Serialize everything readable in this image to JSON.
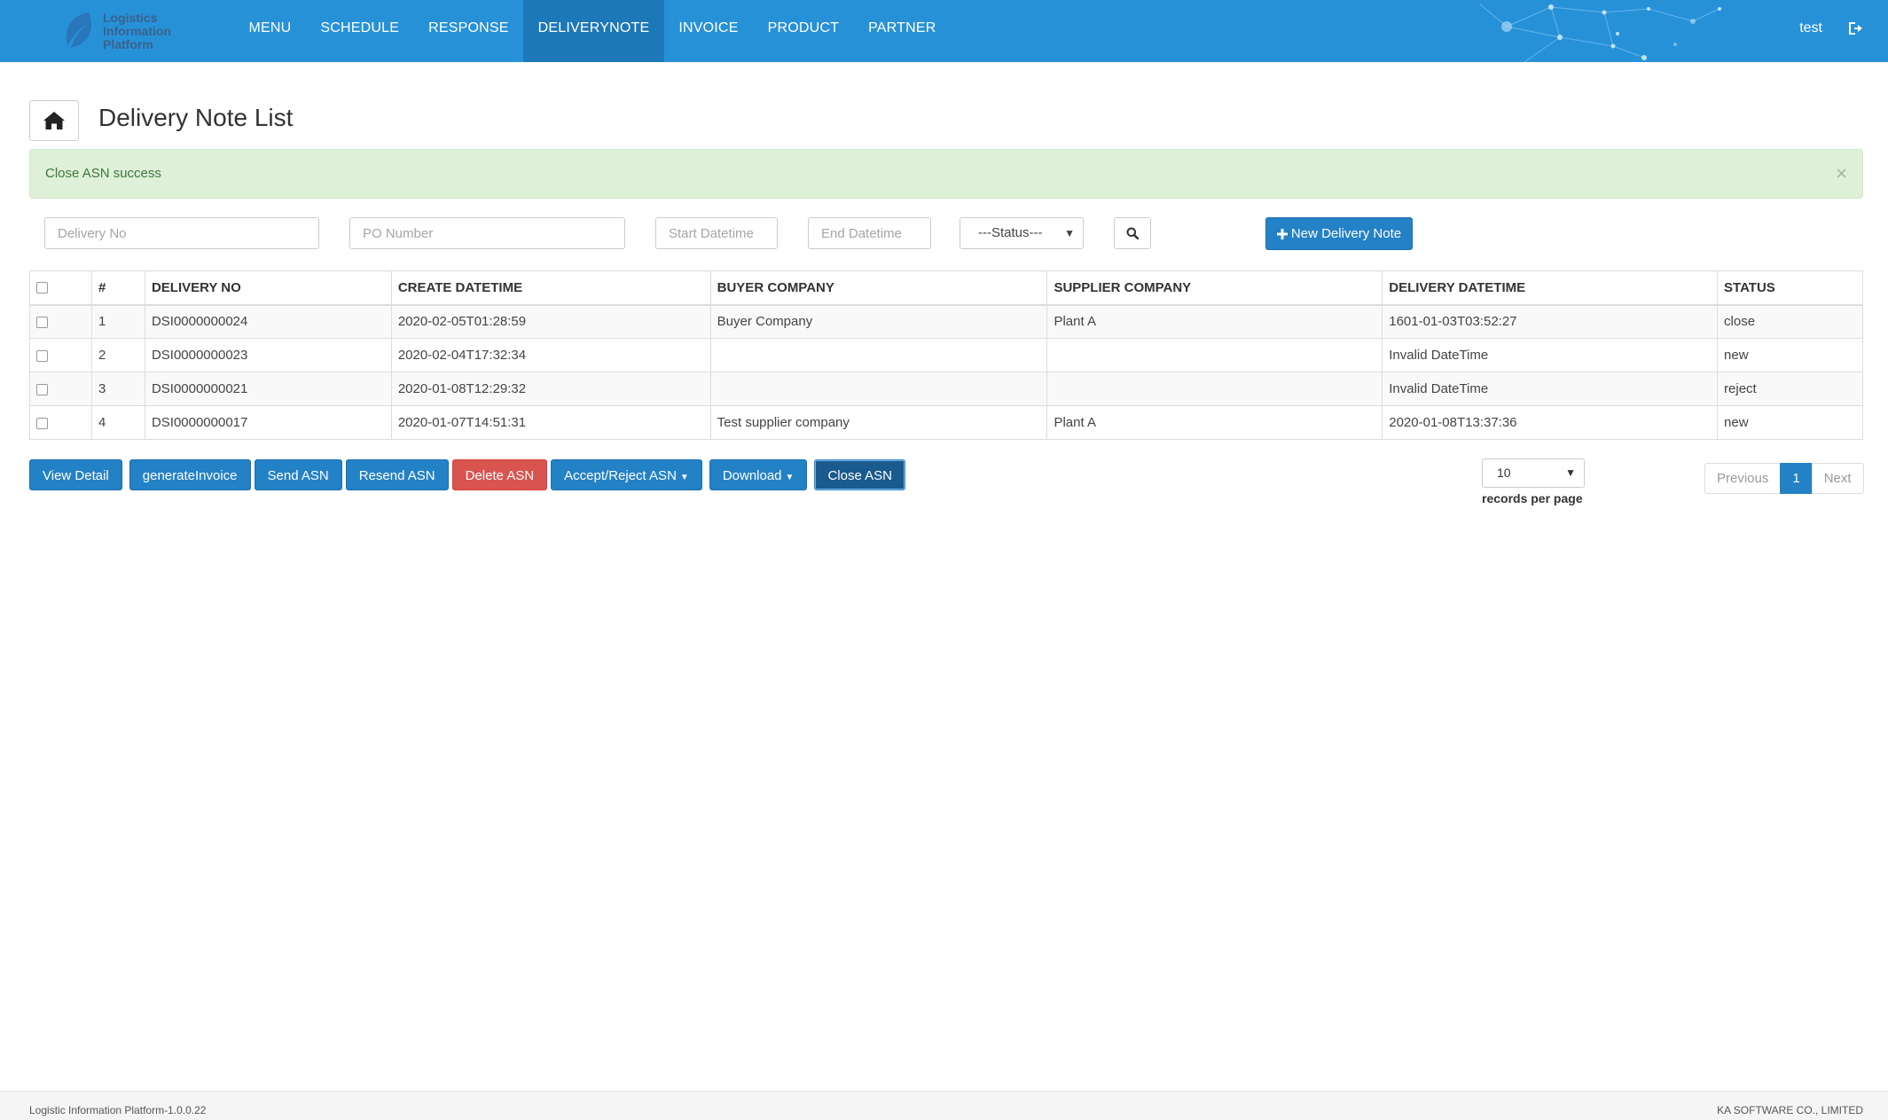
{
  "brand": {
    "logo_text": "Logistics\nInformation\nPlatform"
  },
  "nav": {
    "items": [
      {
        "label": "MENU"
      },
      {
        "label": "SCHEDULE"
      },
      {
        "label": "RESPONSE"
      },
      {
        "label": "DELIVERYNOTE"
      },
      {
        "label": "INVOICE"
      },
      {
        "label": "PRODUCT"
      },
      {
        "label": "PARTNER"
      }
    ],
    "active": "DELIVERYNOTE",
    "user": "test",
    "logout_icon": "logout-icon"
  },
  "page": {
    "title": "Delivery Note List",
    "home_icon": "home-icon"
  },
  "alert": {
    "message": "Close ASN success",
    "close": "×"
  },
  "filters": {
    "delivery_no": {
      "placeholder": "Delivery No",
      "value": ""
    },
    "po_number": {
      "placeholder": "PO Number",
      "value": ""
    },
    "start_datetime": {
      "placeholder": "Start Datetime",
      "value": ""
    },
    "end_datetime": {
      "placeholder": "End Datetime",
      "value": ""
    },
    "status": {
      "selected": "---Status---"
    },
    "search_icon": "search-icon",
    "new_button": "New Delivery Note"
  },
  "table": {
    "headers": [
      "#",
      "DELIVERY NO",
      "CREATE DATETIME",
      "BUYER COMPANY",
      "SUPPLIER COMPANY",
      "DELIVERY DATETIME",
      "STATUS"
    ],
    "rows": [
      {
        "num": "1",
        "delivery_no": "DSI0000000024",
        "create_datetime": "2020-02-05T01:28:59",
        "buyer_company": "Buyer Company",
        "supplier_company": "Plant A",
        "delivery_datetime": "1601-01-03T03:52:27",
        "status": "close"
      },
      {
        "num": "2",
        "delivery_no": "DSI0000000023",
        "create_datetime": "2020-02-04T17:32:34",
        "buyer_company": "",
        "supplier_company": "",
        "delivery_datetime": "Invalid DateTime",
        "status": "new"
      },
      {
        "num": "3",
        "delivery_no": "DSI0000000021",
        "create_datetime": "2020-01-08T12:29:32",
        "buyer_company": "",
        "supplier_company": "",
        "delivery_datetime": "Invalid DateTime",
        "status": "reject"
      },
      {
        "num": "4",
        "delivery_no": "DSI0000000017",
        "create_datetime": "2020-01-07T14:51:31",
        "buyer_company": "Test supplier company",
        "supplier_company": "Plant A",
        "delivery_datetime": "2020-01-08T13:37:36",
        "status": "new"
      }
    ]
  },
  "actions": {
    "view_detail": "View Detail",
    "generate_invoice": "generateInvoice",
    "send_asn": "Send ASN",
    "resend_asn": "Resend ASN",
    "delete_asn": "Delete ASN",
    "accept_reject_asn": "Accept/Reject ASN",
    "download": "Download",
    "close_asn": "Close ASN"
  },
  "pagination": {
    "page_size": "10",
    "records_per_page": "records per page",
    "previous": "Previous",
    "current": "1",
    "next": "Next"
  },
  "footer": {
    "version": "Logistic Information Platform-1.0.0.22",
    "company": "KA SOFTWARE CO., LIMITED"
  },
  "colors": {
    "navbar": "#2791d8",
    "nav_active": "#1c78b8",
    "primary": "#2381c6",
    "danger": "#d9534f",
    "alert_bg": "#dff0d8",
    "alert_text": "#3c763d"
  }
}
